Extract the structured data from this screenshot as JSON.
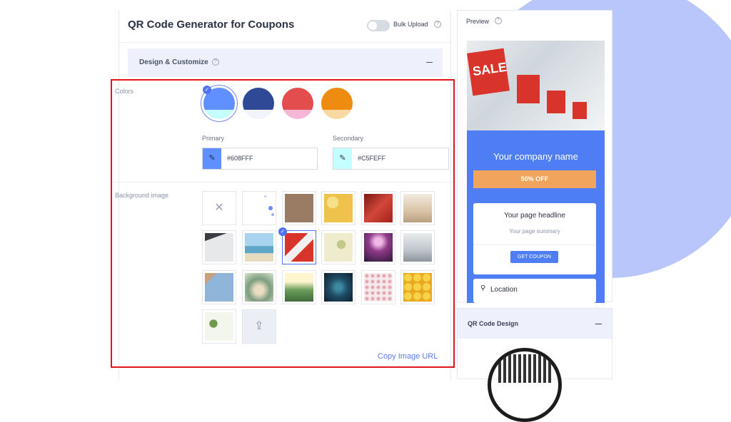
{
  "header": {
    "title": "QR Code Generator for Coupons",
    "bulk_upload_label": "Bulk Upload",
    "bulk_upload_on": false
  },
  "design": {
    "section_title": "Design & Customize"
  },
  "colors": {
    "label": "Colors",
    "swatches": [
      {
        "primary": "#608FFF",
        "secondary": "#C5FEFF",
        "selected": true
      },
      {
        "primary": "#2F4996",
        "secondary": "#F2F4FC",
        "selected": false
      },
      {
        "primary": "#E34D4D",
        "secondary": "#F7B5D8",
        "selected": false
      },
      {
        "primary": "#EE8C12",
        "secondary": "#F9D8A2",
        "selected": false
      }
    ],
    "primary_label": "Primary",
    "primary_value": "#608FFF",
    "secondary_label": "Secondary",
    "secondary_value": "#C5FEFF"
  },
  "background": {
    "label": "Background image",
    "selected_index": 8,
    "thumbnails": [
      {
        "name": "none",
        "color": "#ffffff"
      },
      {
        "name": "dots",
        "color": "#f4f7ff"
      },
      {
        "name": "brown-texture",
        "color": "#9a7b63"
      },
      {
        "name": "yellow-floral",
        "color": "#efc24c"
      },
      {
        "name": "red-abstract",
        "color": "#b2332a"
      },
      {
        "name": "store-interior",
        "color": "#d9c3a7"
      },
      {
        "name": "desk-paper",
        "color": "#e6e8ea"
      },
      {
        "name": "beach-resort",
        "color": "#5fa6c7"
      },
      {
        "name": "sale-flags",
        "color": "#d9342b"
      },
      {
        "name": "leaf-pattern",
        "color": "#e6e2b0"
      },
      {
        "name": "concert-lights",
        "color": "#8f3a87"
      },
      {
        "name": "office",
        "color": "#bfc5cb"
      },
      {
        "name": "world-map",
        "color": "#8fb6d9"
      },
      {
        "name": "palm-trees",
        "color": "#7c9d7e"
      },
      {
        "name": "sunset-valley",
        "color": "#6a9c58"
      },
      {
        "name": "night-sky",
        "color": "#1f4d66"
      },
      {
        "name": "pink-dots",
        "color": "#f1dfe2"
      },
      {
        "name": "emoji-pattern",
        "color": "#f5c33a"
      },
      {
        "name": "green-leaves",
        "color": "#a9c88f"
      },
      {
        "name": "upload",
        "color": "#eceef5"
      }
    ],
    "copy_url_label": "Copy Image URL"
  },
  "preview": {
    "label": "Preview",
    "company_name": "Your company name",
    "offer": "50% OFF",
    "headline": "Your page headline",
    "summary": "Your page summary",
    "cta": "GET COUPON",
    "location": "Location"
  },
  "qr_design": {
    "label": "QR Code Design"
  },
  "icons": {
    "help": "help-circle-icon",
    "picker": "eyedropper-icon",
    "none": "x-icon",
    "upload": "cloud-upload-icon",
    "location": "map-pin-icon",
    "collapse": "minus-icon"
  }
}
